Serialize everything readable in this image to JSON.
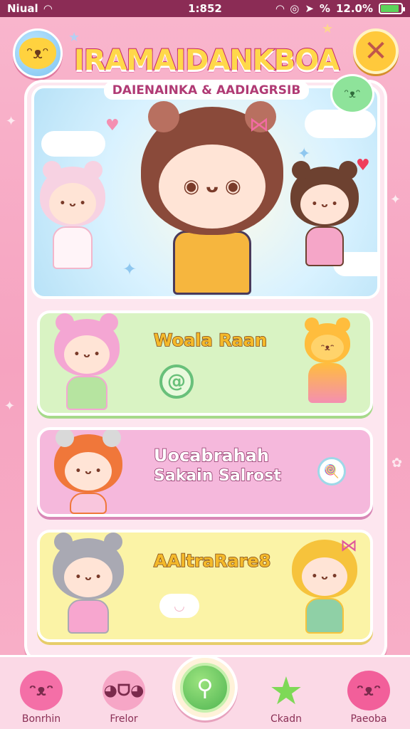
{
  "status_bar": {
    "carrier": "Niual",
    "time": "1:852",
    "battery_text": "12.0%",
    "signal_text": "%",
    "battery_level": 0.9
  },
  "header": {
    "title": "IRAMAIDANKBOA",
    "subtitle": "DAIENAINKA & AADIAGRSIB"
  },
  "rows": [
    {
      "label": "Woala Raan",
      "icon": "at-icon"
    },
    {
      "label": "Uocabrahah",
      "label2": "Sakain Salrost",
      "icon": "lollipop-icon"
    },
    {
      "label": "AAltraRare8",
      "icon": "cloud-icon"
    }
  ],
  "bottom_nav": {
    "items": [
      {
        "label": "Bonrhin",
        "icon": "pink-bear-icon",
        "color": "#f46fa7"
      },
      {
        "label": "Frelor",
        "icon": "pink-monster-icon",
        "color": "#f6a6c6"
      },
      {
        "label": "Ckadn",
        "icon": "green-star-icon",
        "color": "#7ed957"
      },
      {
        "label": "Paeoba",
        "icon": "pink-cat-icon",
        "color": "#f25f9a"
      }
    ],
    "center_icon": "magic-wand-icon"
  },
  "colors": {
    "background": "#f7a6c2",
    "status_bar": "#8b2c55",
    "accent_yellow": "#ffd84a",
    "row_green": "#d9f3c3",
    "row_pink": "#f5b8dc",
    "row_yellow": "#fbf3a6"
  }
}
